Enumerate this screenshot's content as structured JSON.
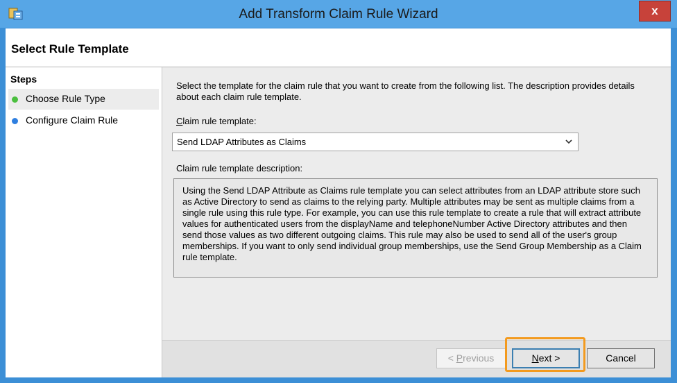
{
  "window": {
    "title": "Add Transform Claim Rule Wizard",
    "close_label": "x",
    "app_icon": "wizard-app-icon"
  },
  "header": {
    "title": "Select Rule Template"
  },
  "steps": {
    "heading": "Steps",
    "items": [
      {
        "label": "Choose Rule Type",
        "status_color": "#4bbf3f",
        "active": true
      },
      {
        "label": "Configure Claim Rule",
        "status_color": "#2f7fe0",
        "active": false
      }
    ]
  },
  "main": {
    "intro": "Select the template for the claim rule that you want to create from the following list. The description provides details about each claim rule template.",
    "template_label_first": "C",
    "template_label_rest": "laim rule template:",
    "template_value": "Send LDAP Attributes as Claims",
    "description_label": "Claim rule template description:",
    "description_text": "Using the Send LDAP Attribute as Claims rule template you can select attributes from an LDAP attribute store such as Active Directory to send as claims to the relying party. Multiple attributes may be sent as multiple claims from a single rule using this rule type. For example, you can use this rule template to create a rule that will extract attribute values for authenticated users from the displayName and telephoneNumber Active Directory attributes and then send those values as two different outgoing claims. This rule may also be used to send all of the user's group memberships. If you want to only send individual group memberships, use the Send Group Membership as a Claim rule template."
  },
  "footer": {
    "prev_prefix": "< ",
    "prev_accel": "P",
    "prev_rest": "revious",
    "next_accel": "N",
    "next_rest": "ext >",
    "cancel_label": "Cancel"
  },
  "colors": {
    "titlebar": "#57a6e6",
    "close": "#c7423a",
    "highlight": "#f39a1e"
  }
}
